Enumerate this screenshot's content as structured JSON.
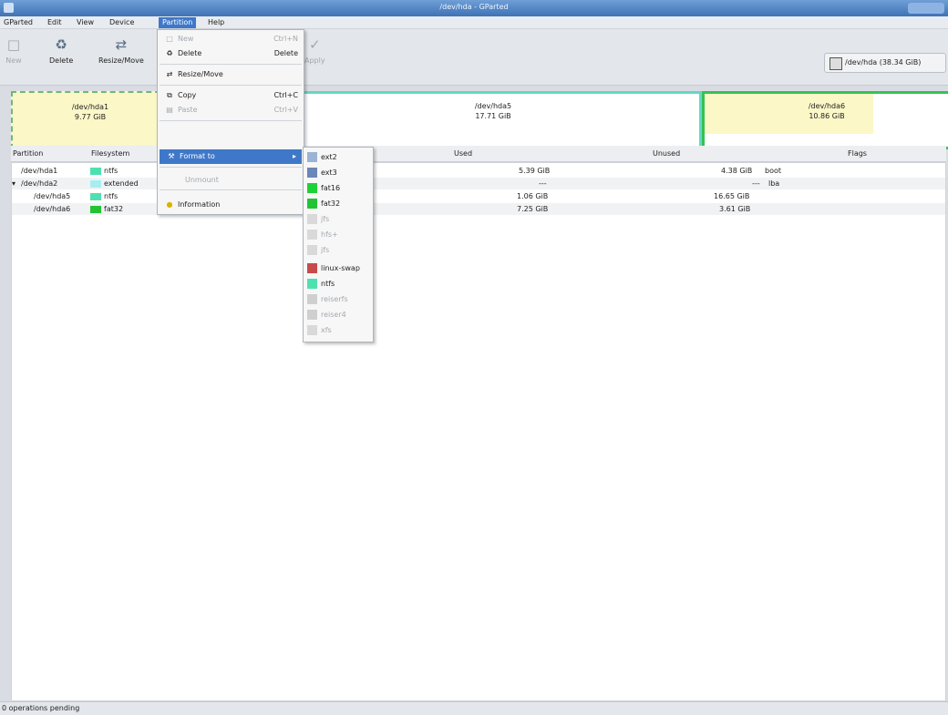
{
  "window": {
    "title": "/dev/hda - GParted"
  },
  "menubar": {
    "items": [
      "GParted",
      "Edit",
      "View",
      "Device",
      "Partition",
      "Help"
    ]
  },
  "toolbar": {
    "new": "New",
    "delete": "Delete",
    "resize": "Resize/Move",
    "apply": "Apply"
  },
  "device": {
    "label": "/dev/hda  (38.34 GiB)"
  },
  "map": {
    "p1": {
      "name": "/dev/hda1",
      "size": "9.77 GiB"
    },
    "p5": {
      "name": "/dev/hda5",
      "size": "17.71 GiB"
    },
    "p6": {
      "name": "/dev/hda6",
      "size": "10.86 GiB"
    }
  },
  "table": {
    "headers": [
      "Partition",
      "Filesystem",
      "Used",
      "Unused",
      "Flags"
    ],
    "rows": [
      {
        "partition": "/dev/hda1",
        "fs": "ntfs",
        "fs_color": "#4fe0b0",
        "used": "5.39 GiB",
        "unused": "4.38 GiB",
        "flags": "boot"
      },
      {
        "partition": "/dev/hda2",
        "fs": "extended",
        "fs_color": "#a6eef0",
        "used": "---",
        "unused": "---",
        "flags": "lba"
      },
      {
        "partition": "/dev/hda5",
        "fs": "ntfs",
        "fs_color": "#4fe0b0",
        "used": "1.06 GiB",
        "unused": "16.65 GiB",
        "flags": ""
      },
      {
        "partition": "/dev/hda6",
        "fs": "fat32",
        "fs_color": "#22c433",
        "used": "7.25 GiB",
        "unused": "3.61 GiB",
        "flags": ""
      }
    ]
  },
  "partition_menu": {
    "new": "New",
    "new_accel": "Ctrl+N",
    "delete": "Delete",
    "delete_accel": "Delete",
    "resize": "Resize/Move",
    "copy": "Copy",
    "copy_accel": "Ctrl+C",
    "paste": "Paste",
    "paste_accel": "Ctrl+V",
    "format": "Format to",
    "unmount": "Unmount",
    "info": "Information"
  },
  "format_menu": [
    {
      "label": "ext2",
      "color": "#9bb3d4",
      "enabled": true
    },
    {
      "label": "ext3",
      "color": "#6b86b8",
      "enabled": true
    },
    {
      "label": "fat16",
      "color": "#1ed235",
      "enabled": true
    },
    {
      "label": "fat32",
      "color": "#22c433",
      "enabled": true
    },
    {
      "label": "jfs",
      "color": "#d9d9d9",
      "enabled": false
    },
    {
      "label": "hfs+",
      "color": "#d9d9d9",
      "enabled": false
    },
    {
      "label": "jfs",
      "color": "#d9d9d9",
      "enabled": false
    },
    {
      "label": "linux-swap",
      "color": "#c84a4a",
      "enabled": true
    },
    {
      "label": "ntfs",
      "color": "#4fe0b0",
      "enabled": true
    },
    {
      "label": "reiserfs",
      "color": "#cfcfcf",
      "enabled": false
    },
    {
      "label": "reiser4",
      "color": "#cfcfcf",
      "enabled": false
    },
    {
      "label": "xfs",
      "color": "#d9d9d9",
      "enabled": false
    }
  ],
  "status": {
    "text": "0 operations pending"
  }
}
